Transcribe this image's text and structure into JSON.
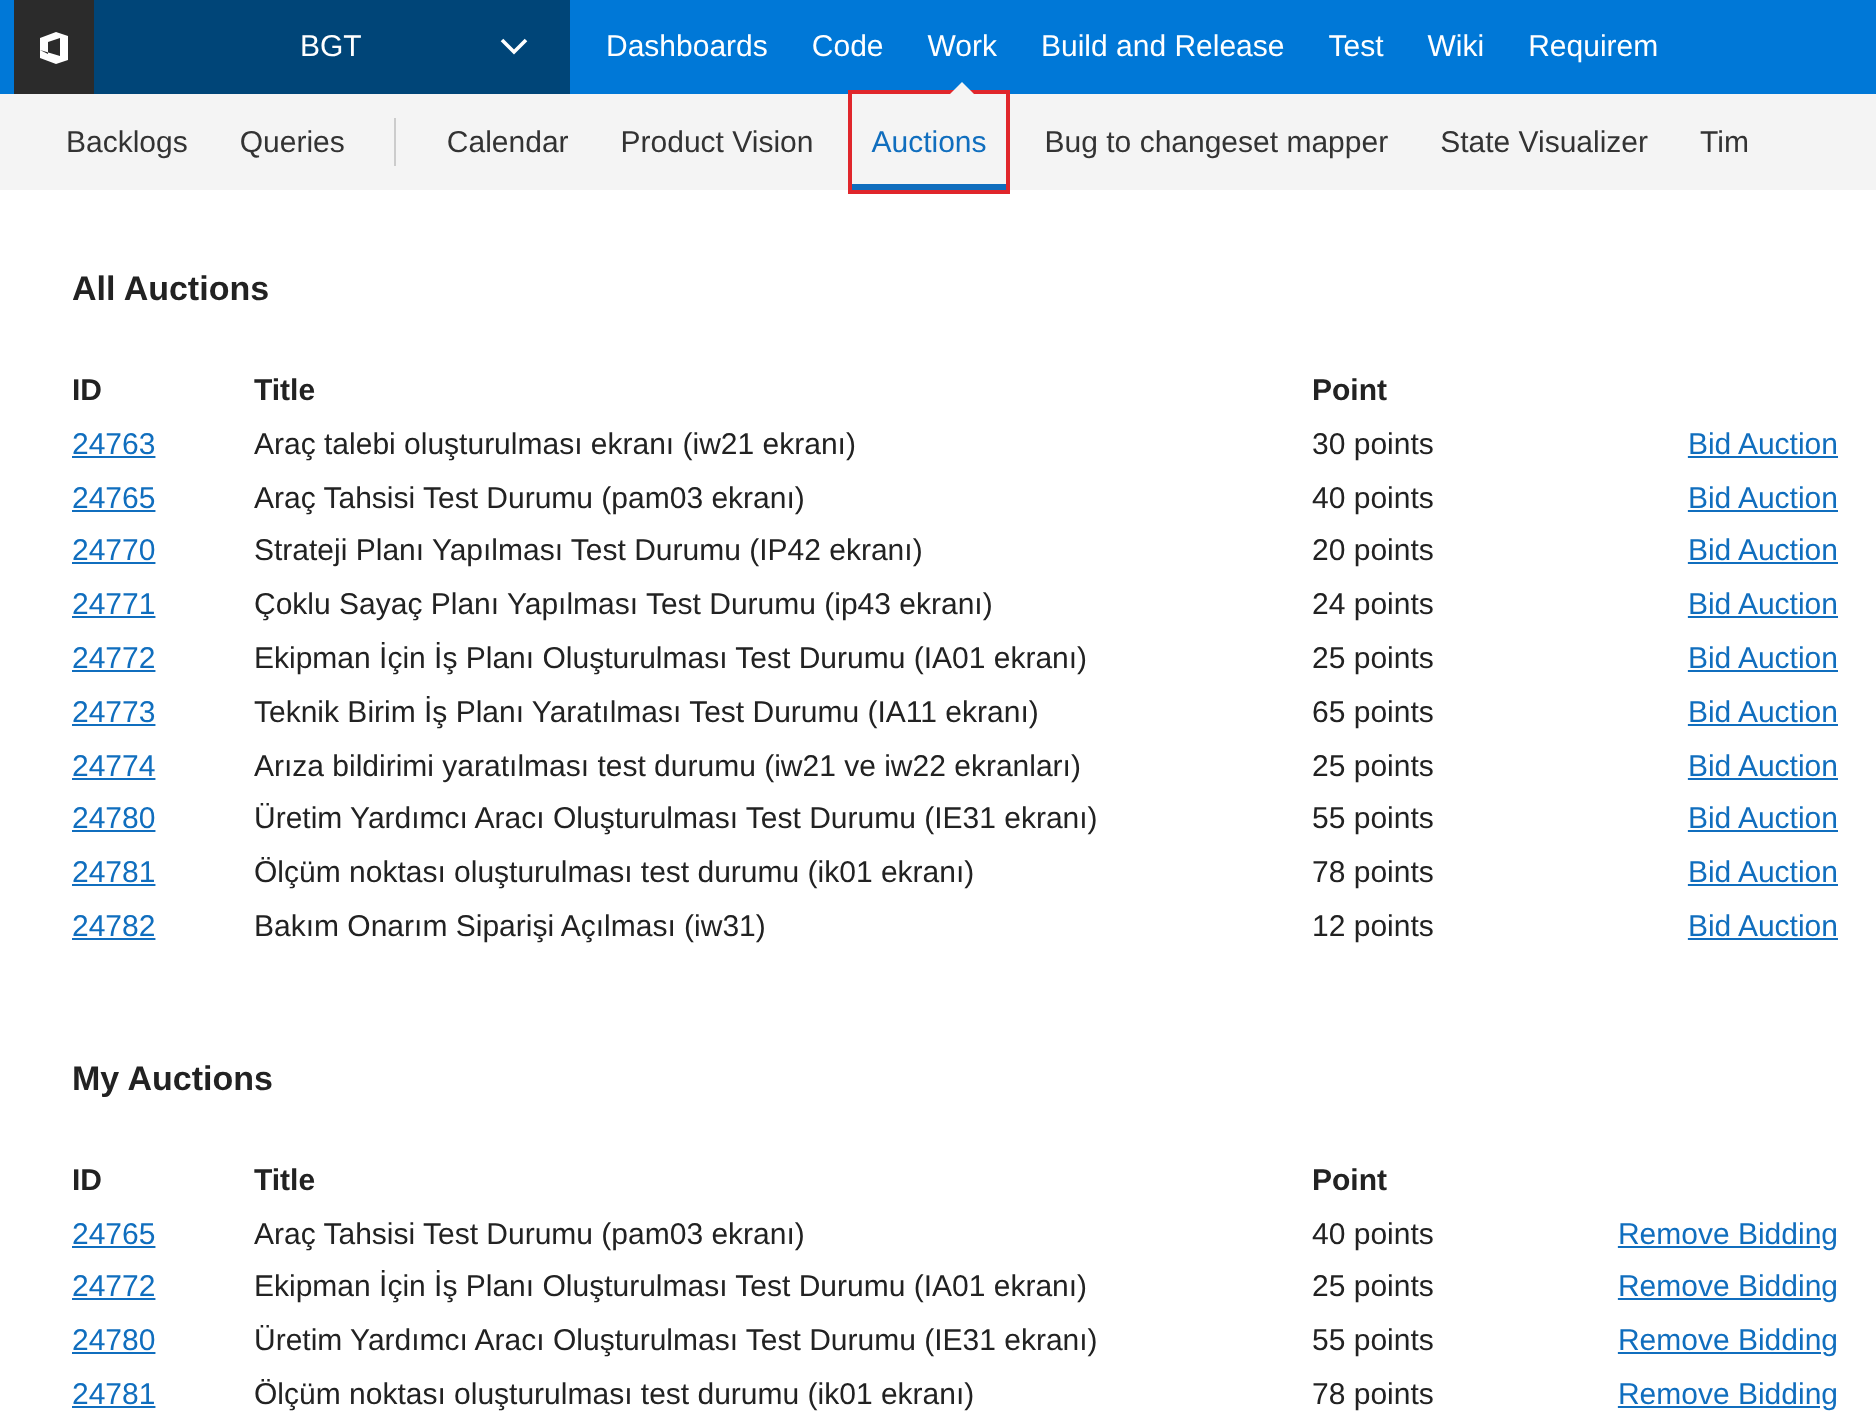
{
  "top_nav": {
    "project": "BGT",
    "items": [
      {
        "label": "Dashboards",
        "selected": false
      },
      {
        "label": "Code",
        "selected": false
      },
      {
        "label": "Work",
        "selected": true
      },
      {
        "label": "Build and Release",
        "selected": false
      },
      {
        "label": "Test",
        "selected": false
      },
      {
        "label": "Wiki",
        "selected": false
      },
      {
        "label": "Requirem",
        "selected": false
      }
    ]
  },
  "sub_nav": {
    "items": [
      {
        "label": "Backlogs",
        "selected": false,
        "divider_after": false
      },
      {
        "label": "Queries",
        "selected": false,
        "divider_after": true
      },
      {
        "label": "Calendar",
        "selected": false,
        "divider_after": false
      },
      {
        "label": "Product Vision",
        "selected": false,
        "divider_after": false
      },
      {
        "label": "Auctions",
        "selected": true,
        "divider_after": false
      },
      {
        "label": "Bug to changeset mapper",
        "selected": false,
        "divider_after": false
      },
      {
        "label": "State Visualizer",
        "selected": false,
        "divider_after": false
      },
      {
        "label": "Tim",
        "selected": false,
        "divider_after": false
      }
    ]
  },
  "sections": [
    {
      "title": "All Auctions",
      "columns": [
        "ID",
        "Title",
        "Point"
      ],
      "rows": [
        {
          "id": "24763",
          "title": "Araç talebi oluşturulması ekranı (iw21 ekranı)",
          "point": "30 points",
          "action": "Bid Auction"
        },
        {
          "id": "24765",
          "title": "Araç Tahsisi Test Durumu (pam03 ekranı)",
          "point": "40 points",
          "action": "Bid Auction"
        },
        {
          "id": "24770",
          "title": "Strateji Planı Yapılması Test Durumu (IP42 ekranı)",
          "point": "20 points",
          "action": "Bid Auction"
        },
        {
          "id": "24771",
          "title": "Çoklu Sayaç Planı Yapılması Test Durumu (ip43 ekranı)",
          "point": "24 points",
          "action": "Bid Auction"
        },
        {
          "id": "24772",
          "title": "Ekipman İçin İş Planı Oluşturulması Test Durumu (IA01 ekranı)",
          "point": "25 points",
          "action": "Bid Auction"
        },
        {
          "id": "24773",
          "title": "Teknik Birim İş Planı Yaratılması Test Durumu (IA11 ekranı)",
          "point": "65 points",
          "action": "Bid Auction"
        },
        {
          "id": "24774",
          "title": "Arıza bildirimi yaratılması test durumu (iw21 ve iw22 ekranları)",
          "point": "25 points",
          "action": "Bid Auction"
        },
        {
          "id": "24780",
          "title": "Üretim Yardımcı Aracı Oluşturulması Test Durumu (IE31 ekranı)",
          "point": "55 points",
          "action": "Bid Auction"
        },
        {
          "id": "24781",
          "title": "Ölçüm noktası oluşturulması test durumu (ik01 ekranı)",
          "point": "78 points",
          "action": "Bid Auction"
        },
        {
          "id": "24782",
          "title": "Bakım Onarım Siparişi Açılması (iw31)",
          "point": "12 points",
          "action": "Bid Auction"
        }
      ]
    },
    {
      "title": "My Auctions",
      "columns": [
        "ID",
        "Title",
        "Point"
      ],
      "rows": [
        {
          "id": "24765",
          "title": "Araç Tahsisi Test Durumu (pam03 ekranı)",
          "point": "40 points",
          "action": "Remove Bidding"
        },
        {
          "id": "24772",
          "title": "Ekipman İçin İş Planı Oluşturulması Test Durumu (IA01 ekranı)",
          "point": "25 points",
          "action": "Remove Bidding"
        },
        {
          "id": "24780",
          "title": "Üretim Yardımcı Aracı Oluşturulması Test Durumu (IE31 ekranı)",
          "point": "55 points",
          "action": "Remove Bidding"
        },
        {
          "id": "24781",
          "title": "Ölçüm noktası oluşturulması test durumu (ik01 ekranı)",
          "point": "78 points",
          "action": "Remove Bidding"
        }
      ]
    }
  ]
}
